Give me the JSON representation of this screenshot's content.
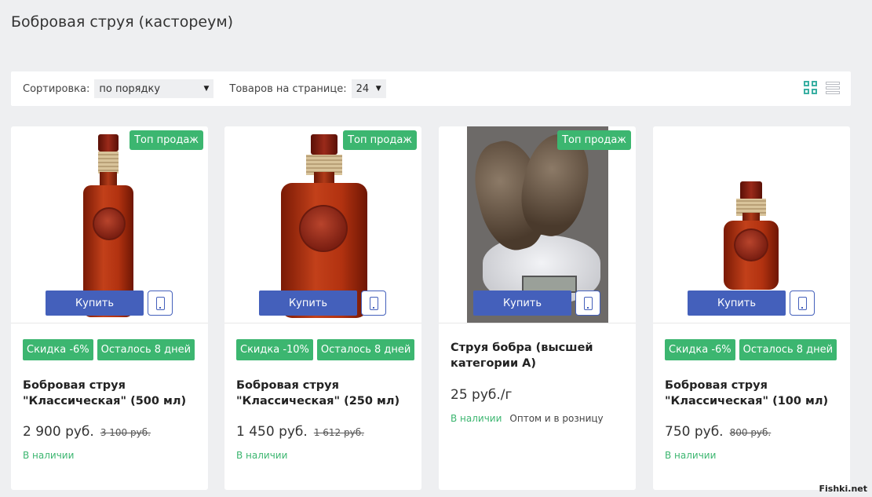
{
  "page_title": "Бобровая струя (кастореум)",
  "toolbar": {
    "sort_label": "Сортировка:",
    "sort_value": "по порядку",
    "per_page_label": "Товаров на странице:",
    "per_page_value": "24"
  },
  "products": [
    {
      "top_badge": "Топ продаж",
      "buy_label": "Купить",
      "discount": "Скидка -6%",
      "days_left": "Осталось 8 дней",
      "name": "Бобровая струя \"Классическая\" (500 мл)",
      "price": "2 900 руб.",
      "old_price": "3 100 руб.",
      "stock": "В наличии"
    },
    {
      "top_badge": "Топ продаж",
      "buy_label": "Купить",
      "discount": "Скидка -10%",
      "days_left": "Осталось 8 дней",
      "name": "Бобровая струя \"Классическая\" (250 мл)",
      "price": "1 450 руб.",
      "old_price": "1 612 руб.",
      "stock": "В наличии"
    },
    {
      "top_badge": "Топ продаж",
      "buy_label": "Купить",
      "name": "Струя бобра (высшей категории А)",
      "price": "25 руб./г",
      "stock": "В наличии",
      "note": "Оптом и в розницу"
    },
    {
      "buy_label": "Купить",
      "discount": "Скидка -6%",
      "days_left": "Осталось 8 дней",
      "name": "Бобровая струя \"Классическая\" (100 мл)",
      "price": "750 руб.",
      "old_price": "800 руб.",
      "stock": "В наличии"
    }
  ],
  "watermark": "Fishki.net",
  "colors": {
    "accent_green": "#3cb670",
    "button_blue": "#4460bb",
    "toggle_teal": "#3bb0a3"
  }
}
